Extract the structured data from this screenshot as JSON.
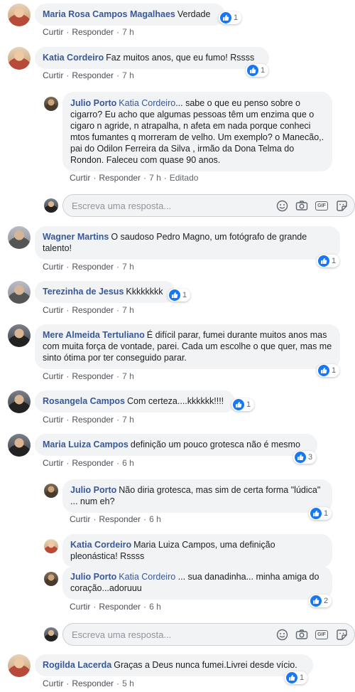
{
  "labels": {
    "like": "Curtir",
    "reply": "Responder",
    "edited": "Editado"
  },
  "reply_placeholder": "Escreva uma resposta...",
  "comments": [
    {
      "name": "Maria Rosa Campos Magalhaes",
      "text": "Verdade",
      "time": "7 h",
      "likes": "1"
    },
    {
      "name": "Katia Cordeiro",
      "text": "Faz muitos anos, que eu fumo! Rssss",
      "time": "7 h",
      "likes": "1"
    },
    {
      "name": "Julio Porto",
      "mention": "Katia Cordeiro",
      "text": "... sabe o que eu penso sobre o cigarro? Eu acho que algumas pessoas têm um enzima que o cigaro n agride, n atrapalha, n afeta em nada porque conheci mtos fumantes q morreram de velho. Um exemplo? o Manecão,. pai do Odilon Ferreira da Silva , irmão da Dona Telma do Rondon. Faleceu com quase 90 anos.",
      "time": "7 h"
    },
    {
      "name": "Wagner Martins",
      "text": "O saudoso Pedro Magno, um fotógrafo de grande talento!",
      "time": "7 h",
      "likes": "1"
    },
    {
      "name": "Terezinha de Jesus",
      "text": "Kkkkkkkk",
      "time": "7 h",
      "likes": "1"
    },
    {
      "name": "Mere Almeida Tertuliano",
      "text": "É difícil parar, fumei durante muitos anos mas com muita força de vontade, parei. Cada um escolhe o que quer, mas me sinto ótima por ter conseguido parar.",
      "time": "7 h",
      "likes": "1"
    },
    {
      "name": "Rosangela Campos",
      "text": "Com certeza....kkkkkk!!!!",
      "time": "7 h",
      "likes": "1"
    },
    {
      "name": "Maria Luiza Campos",
      "text": "definição um pouco grotesca não é mesmo",
      "time": "6 h",
      "likes": "3"
    },
    {
      "name": "Julio Porto",
      "text": "Não diria grotesca, mas sim de certa forma \"lúdica\" ... num eh?",
      "time": "6 h",
      "likes": "1"
    },
    {
      "name": "Katia Cordeiro",
      "text": "Maria Luiza Campos, uma definição pleonástica! Rssss"
    },
    {
      "name": "Julio Porto",
      "mention": "Katia Cordeiro",
      "text": " ... sua danadinha... minha amiga do coração...adoruuu",
      "time": "6 h",
      "likes": "2"
    },
    {
      "name": "Rogilda Lacerda",
      "text": "Graças a Deus nunca fumei.Livrei desde vício.",
      "time": "5 h",
      "likes": "1"
    }
  ],
  "colors": {
    "name_link": "#385898",
    "bubble_bg": "#f2f3f5",
    "like_blue": "#1877f2",
    "meta_gray": "#606770"
  }
}
